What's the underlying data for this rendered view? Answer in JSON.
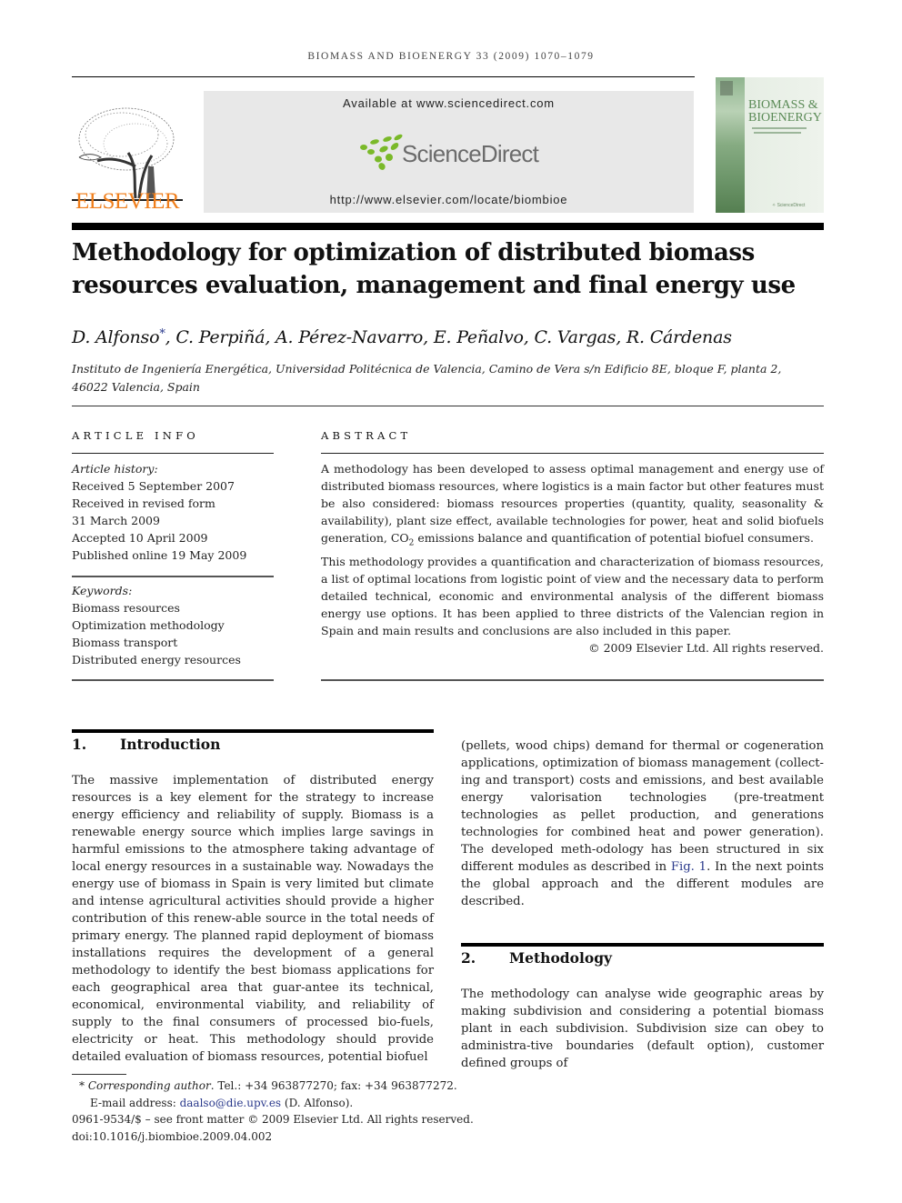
{
  "running_head": "BIOMASS AND BIOENERGY 33 (2009) 1070–1079",
  "banner": {
    "publisher_name": "ELSEVIER",
    "available_at": "Available at www.sciencedirect.com",
    "sciencedirect_logo": "ScienceDirect",
    "journal_url": "http://www.elsevier.com/locate/biombioe",
    "cover_title_line1": "BIOMASS &",
    "cover_title_line2": "BIOENERGY",
    "colors": {
      "elsevier_orange": "#f07e1b",
      "sciencedirect_green": "#7ab929",
      "sciencedirect_gray": "#6b6b6b",
      "banner_bg": "#e8e8e8",
      "cover_green": "#5a8a56"
    }
  },
  "article": {
    "title": "Methodology for optimization of distributed biomass resources evaluation, management and final energy use",
    "authors_first": "D. Alfonso",
    "corresponding_mark": "*",
    "authors_rest": ", C. Perpiñá, A. Pérez-Navarro, E. Peñalvo, C. Vargas, R. Cárdenas",
    "affiliation_line1": "Instituto de Ingeniería Energética, Universidad Politécnica de Valencia, Camino de Vera s/n Edificio 8E, bloque F, planta 2,",
    "affiliation_line2": "46022 Valencia, Spain"
  },
  "article_info": {
    "heading": "ARTICLE INFO",
    "history_label": "Article history:",
    "history": [
      "Received 5 September 2007",
      "Received in revised form",
      "31 March 2009",
      "Accepted 10 April 2009",
      "Published online 19 May 2009"
    ],
    "keywords_label": "Keywords:",
    "keywords": [
      "Biomass resources",
      "Optimization methodology",
      "Biomass transport",
      "Distributed energy resources"
    ]
  },
  "abstract": {
    "heading": "ABSTRACT",
    "para1_a": "A methodology has been developed to assess optimal management and energy use of distributed biomass resources, where logistics is a main factor but other features must be also considered: biomass resources properties (quantity, quality, seasonality & availability), plant size effect, available technologies for power, heat and solid biofuels generation, CO",
    "para1_sub": "2",
    "para1_b": " emissions balance and quantification of potential biofuel consumers.",
    "para2": "This methodology provides a quantification and characterization of biomass resources, a list of optimal locations from logistic point of view and the necessary data to perform detailed technical, economic and environmental analysis of the different biomass energy use options. It has been applied to three districts of the Valencian region in Spain and main results and conclusions are also included in this paper.",
    "copyright": "© 2009 Elsevier Ltd. All rights reserved."
  },
  "sections": {
    "intro": {
      "number": "1.",
      "title": "Introduction",
      "text": "The massive implementation of distributed energy resources is a key element for the strategy to increase energy efficiency and reliability of supply. Biomass is a renewable energy source which implies large savings in harmful emissions to the atmosphere taking advantage of local energy resources in a sustainable way. Nowadays the energy use of biomass in Spain is very limited but climate and intense agricultural activities should provide a higher contribution of this renew-able source in the total needs of primary energy. The planned rapid deployment of biomass installations requires the development of a general methodology to identify the best biomass applications for each geographical area that guar-antee its technical, economical, environmental viability, and reliability of supply to the final consumers of processed bio-fuels, electricity or heat. This methodology should provide detailed evaluation of biomass resources, potential biofuel"
    },
    "intro_cont": {
      "text_a": "(pellets, wood chips) demand for thermal or cogeneration applications, optimization of biomass management (collect-ing and transport) costs and emissions, and best available energy valorisation technologies (pre-treatment technologies as pellet production, and generations technologies for combined heat and power generation). The developed meth-odology has been structured in six different modules as described in ",
      "fig_link": "Fig. 1",
      "text_b": ". In the next points the global approach and the different modules are described."
    },
    "methodology": {
      "number": "2.",
      "title": "Methodology",
      "text": "The methodology can analyse wide geographic areas by making subdivision and considering a potential biomass plant in each subdivision. Subdivision size can obey to administra-tive boundaries (default option), customer defined groups of"
    }
  },
  "footnotes": {
    "star": "*",
    "corresponding_label": "Corresponding author",
    "contact": ". Tel.: +34 963877270; fax: +34 963877272.",
    "email_label": "E-mail address: ",
    "email": "daalso@die.upv.es",
    "email_suffix": " (D. Alfonso).",
    "issn": "0961-9534/$ – see front matter © 2009 Elsevier Ltd. All rights reserved.",
    "doi": "doi:10.1016/j.biombioe.2009.04.002"
  }
}
